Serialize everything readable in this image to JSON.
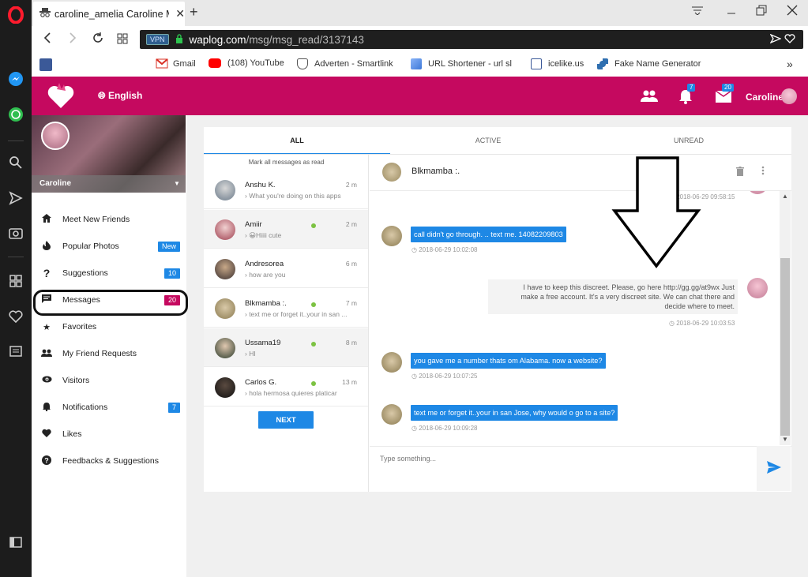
{
  "browser": {
    "tab_title": "caroline_amelia Caroline M",
    "tab_close": "✕",
    "new_tab": "+",
    "url_host": "waplog.com",
    "url_path": "/msg/msg_read/3137143",
    "vpn_label": "VPN"
  },
  "bookmarks": [
    {
      "label": "Gmail"
    },
    {
      "label": "(108) YouTube"
    },
    {
      "label": "Adverten - Smartlink"
    },
    {
      "label": "URL Shortener - url sl"
    },
    {
      "label": "icelike.us"
    },
    {
      "label": "Fake Name Generator"
    }
  ],
  "bookmarks_more": "»",
  "header": {
    "language": "English",
    "notifications_count": "7",
    "messages_count": "20",
    "user_name": "Caroline"
  },
  "profile": {
    "name": "Caroline"
  },
  "menu": [
    {
      "label": "Meet New Friends",
      "badge": ""
    },
    {
      "label": "Popular Photos",
      "badge": "New"
    },
    {
      "label": "Suggestions",
      "badge": "10"
    },
    {
      "label": "Messages",
      "badge": "20"
    },
    {
      "label": "Favorites",
      "badge": ""
    },
    {
      "label": "My Friend Requests",
      "badge": ""
    },
    {
      "label": "Visitors",
      "badge": ""
    },
    {
      "label": "Notifications",
      "badge": "7"
    },
    {
      "label": "Likes",
      "badge": ""
    },
    {
      "label": "Feedbacks & Suggestions",
      "badge": ""
    }
  ],
  "colors": {
    "brand": "#c5095f",
    "accent": "#1e88e5",
    "online": "#7cc242"
  },
  "tabs": [
    {
      "label": "ALL",
      "active": true
    },
    {
      "label": "ACTIVE",
      "active": false
    },
    {
      "label": "UNREAD",
      "active": false
    }
  ],
  "mark_all_read": "Mark all messages as read",
  "conversations": [
    {
      "name": "Anshu K.",
      "preview": "› What you're doing on this apps",
      "time": "2 m",
      "online": false
    },
    {
      "name": "Amiir",
      "preview": "› 😀Hiiii cute",
      "time": "2 m",
      "online": true
    },
    {
      "name": "Andresorea",
      "preview": "› how are you",
      "time": "6 m",
      "online": false
    },
    {
      "name": "Blkmamba :.",
      "preview": "› text me or forget it..your in san ...",
      "time": "7 m",
      "online": true
    },
    {
      "name": "Ussama19",
      "preview": "› HI",
      "time": "8 m",
      "online": true
    },
    {
      "name": "Carlos G.",
      "preview": "› hola hermosa quieres platicar",
      "time": "13 m",
      "online": true
    }
  ],
  "next_label": "NEXT",
  "chat": {
    "partner_name": "Blkmamba :.",
    "messages": [
      {
        "from": "me",
        "text": "",
        "time": "2018-06-29 09:58:15"
      },
      {
        "from": "them",
        "text": "call didn't go through. .. text me. 14082209803",
        "time": "2018-06-29 10:02:08"
      },
      {
        "from": "me",
        "lines": [
          "I have to keep this discreet. Please, go here http://gg.gg/at9wx Just",
          "make a free account. It's a very discreet site. We can chat there and",
          "decide where to meet."
        ],
        "time": "2018-06-29 10:03:53"
      },
      {
        "from": "them",
        "text": "you gave me a number thats om Alabama. now a website?",
        "time": "2018-06-29 10:07:25"
      },
      {
        "from": "them",
        "text": "text me or forget it..your in san Jose, why would o go to a site?",
        "time": "2018-06-29 10:09:28"
      }
    ],
    "compose_placeholder": "Type something..."
  }
}
